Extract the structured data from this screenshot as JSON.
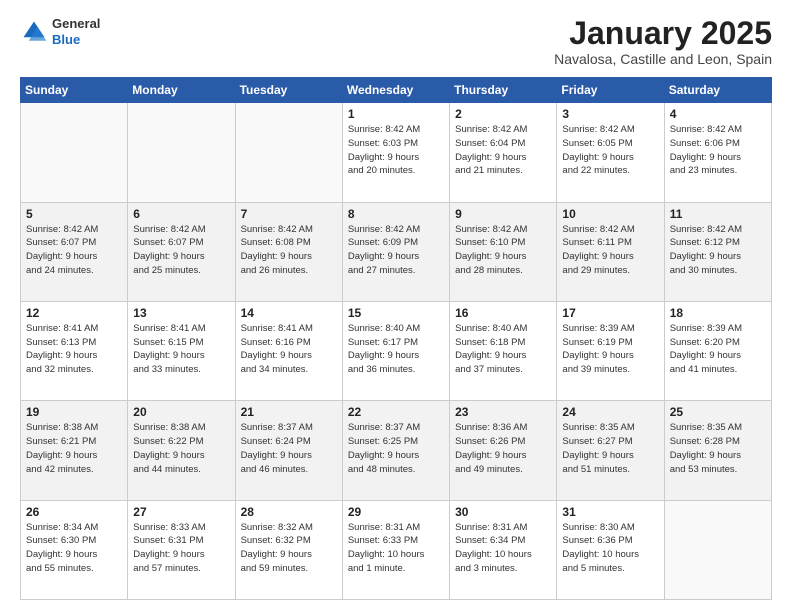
{
  "header": {
    "logo_general": "General",
    "logo_blue": "Blue",
    "month_title": "January 2025",
    "subtitle": "Navalosa, Castille and Leon, Spain"
  },
  "weekdays": [
    "Sunday",
    "Monday",
    "Tuesday",
    "Wednesday",
    "Thursday",
    "Friday",
    "Saturday"
  ],
  "weeks": [
    [
      {
        "day": "",
        "detail": ""
      },
      {
        "day": "",
        "detail": ""
      },
      {
        "day": "",
        "detail": ""
      },
      {
        "day": "1",
        "detail": "Sunrise: 8:42 AM\nSunset: 6:03 PM\nDaylight: 9 hours\nand 20 minutes."
      },
      {
        "day": "2",
        "detail": "Sunrise: 8:42 AM\nSunset: 6:04 PM\nDaylight: 9 hours\nand 21 minutes."
      },
      {
        "day": "3",
        "detail": "Sunrise: 8:42 AM\nSunset: 6:05 PM\nDaylight: 9 hours\nand 22 minutes."
      },
      {
        "day": "4",
        "detail": "Sunrise: 8:42 AM\nSunset: 6:06 PM\nDaylight: 9 hours\nand 23 minutes."
      }
    ],
    [
      {
        "day": "5",
        "detail": "Sunrise: 8:42 AM\nSunset: 6:07 PM\nDaylight: 9 hours\nand 24 minutes."
      },
      {
        "day": "6",
        "detail": "Sunrise: 8:42 AM\nSunset: 6:07 PM\nDaylight: 9 hours\nand 25 minutes."
      },
      {
        "day": "7",
        "detail": "Sunrise: 8:42 AM\nSunset: 6:08 PM\nDaylight: 9 hours\nand 26 minutes."
      },
      {
        "day": "8",
        "detail": "Sunrise: 8:42 AM\nSunset: 6:09 PM\nDaylight: 9 hours\nand 27 minutes."
      },
      {
        "day": "9",
        "detail": "Sunrise: 8:42 AM\nSunset: 6:10 PM\nDaylight: 9 hours\nand 28 minutes."
      },
      {
        "day": "10",
        "detail": "Sunrise: 8:42 AM\nSunset: 6:11 PM\nDaylight: 9 hours\nand 29 minutes."
      },
      {
        "day": "11",
        "detail": "Sunrise: 8:42 AM\nSunset: 6:12 PM\nDaylight: 9 hours\nand 30 minutes."
      }
    ],
    [
      {
        "day": "12",
        "detail": "Sunrise: 8:41 AM\nSunset: 6:13 PM\nDaylight: 9 hours\nand 32 minutes."
      },
      {
        "day": "13",
        "detail": "Sunrise: 8:41 AM\nSunset: 6:15 PM\nDaylight: 9 hours\nand 33 minutes."
      },
      {
        "day": "14",
        "detail": "Sunrise: 8:41 AM\nSunset: 6:16 PM\nDaylight: 9 hours\nand 34 minutes."
      },
      {
        "day": "15",
        "detail": "Sunrise: 8:40 AM\nSunset: 6:17 PM\nDaylight: 9 hours\nand 36 minutes."
      },
      {
        "day": "16",
        "detail": "Sunrise: 8:40 AM\nSunset: 6:18 PM\nDaylight: 9 hours\nand 37 minutes."
      },
      {
        "day": "17",
        "detail": "Sunrise: 8:39 AM\nSunset: 6:19 PM\nDaylight: 9 hours\nand 39 minutes."
      },
      {
        "day": "18",
        "detail": "Sunrise: 8:39 AM\nSunset: 6:20 PM\nDaylight: 9 hours\nand 41 minutes."
      }
    ],
    [
      {
        "day": "19",
        "detail": "Sunrise: 8:38 AM\nSunset: 6:21 PM\nDaylight: 9 hours\nand 42 minutes."
      },
      {
        "day": "20",
        "detail": "Sunrise: 8:38 AM\nSunset: 6:22 PM\nDaylight: 9 hours\nand 44 minutes."
      },
      {
        "day": "21",
        "detail": "Sunrise: 8:37 AM\nSunset: 6:24 PM\nDaylight: 9 hours\nand 46 minutes."
      },
      {
        "day": "22",
        "detail": "Sunrise: 8:37 AM\nSunset: 6:25 PM\nDaylight: 9 hours\nand 48 minutes."
      },
      {
        "day": "23",
        "detail": "Sunrise: 8:36 AM\nSunset: 6:26 PM\nDaylight: 9 hours\nand 49 minutes."
      },
      {
        "day": "24",
        "detail": "Sunrise: 8:35 AM\nSunset: 6:27 PM\nDaylight: 9 hours\nand 51 minutes."
      },
      {
        "day": "25",
        "detail": "Sunrise: 8:35 AM\nSunset: 6:28 PM\nDaylight: 9 hours\nand 53 minutes."
      }
    ],
    [
      {
        "day": "26",
        "detail": "Sunrise: 8:34 AM\nSunset: 6:30 PM\nDaylight: 9 hours\nand 55 minutes."
      },
      {
        "day": "27",
        "detail": "Sunrise: 8:33 AM\nSunset: 6:31 PM\nDaylight: 9 hours\nand 57 minutes."
      },
      {
        "day": "28",
        "detail": "Sunrise: 8:32 AM\nSunset: 6:32 PM\nDaylight: 9 hours\nand 59 minutes."
      },
      {
        "day": "29",
        "detail": "Sunrise: 8:31 AM\nSunset: 6:33 PM\nDaylight: 10 hours\nand 1 minute."
      },
      {
        "day": "30",
        "detail": "Sunrise: 8:31 AM\nSunset: 6:34 PM\nDaylight: 10 hours\nand 3 minutes."
      },
      {
        "day": "31",
        "detail": "Sunrise: 8:30 AM\nSunset: 6:36 PM\nDaylight: 10 hours\nand 5 minutes."
      },
      {
        "day": "",
        "detail": ""
      }
    ]
  ]
}
